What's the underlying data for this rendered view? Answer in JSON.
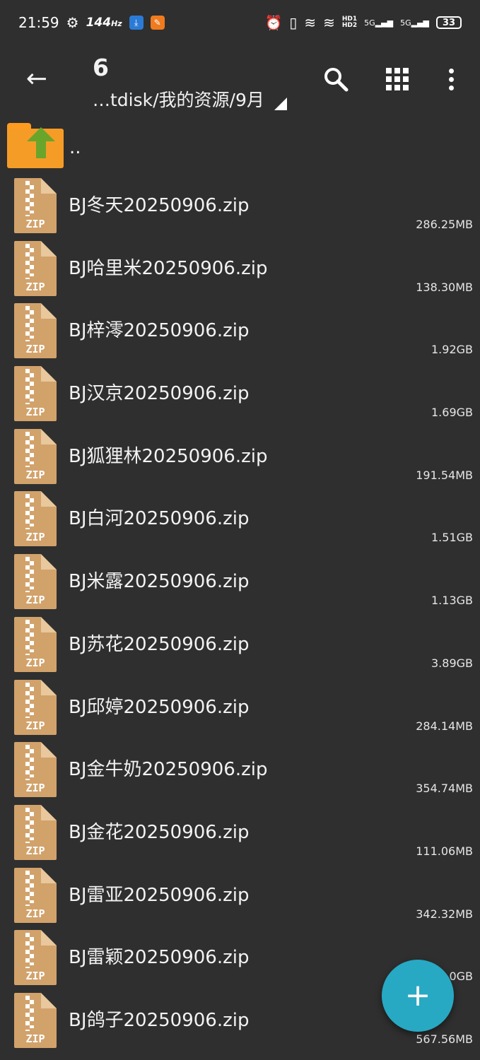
{
  "status_bar": {
    "time": "21:59",
    "refresh_rate": "144",
    "refresh_unit": "Hz",
    "network_labels": [
      "HD1",
      "HD2",
      "5G",
      "5G"
    ],
    "battery": "33"
  },
  "app_bar": {
    "title": "6",
    "path": "…tdisk/我的资源/9月"
  },
  "parent_label": "..",
  "files": [
    {
      "name": "BJ冬天20250906.zip",
      "size": "286.25MB"
    },
    {
      "name": "BJ哈里米20250906.zip",
      "size": "138.30MB"
    },
    {
      "name": "BJ梓澪20250906.zip",
      "size": "1.92GB"
    },
    {
      "name": "BJ汉京20250906.zip",
      "size": "1.69GB"
    },
    {
      "name": "BJ狐狸林20250906.zip",
      "size": "191.54MB"
    },
    {
      "name": "BJ白河20250906.zip",
      "size": "1.51GB"
    },
    {
      "name": "BJ米露20250906.zip",
      "size": "1.13GB"
    },
    {
      "name": "BJ苏花20250906.zip",
      "size": "3.89GB"
    },
    {
      "name": "BJ邱婷20250906.zip",
      "size": "284.14MB"
    },
    {
      "name": "BJ金牛奶20250906.zip",
      "size": "354.74MB"
    },
    {
      "name": "BJ金花20250906.zip",
      "size": "111.06MB"
    },
    {
      "name": "BJ雷亚20250906.zip",
      "size": "342.32MB"
    },
    {
      "name": "BJ雷颖20250906.zip",
      "size": "0GB"
    },
    {
      "name": "BJ鸽子20250906.zip",
      "size": "567.56MB"
    }
  ],
  "zip_label": "ZIP",
  "fab_symbol": "+",
  "colors": {
    "background": "#2f2f2f",
    "fab": "#27a9c4",
    "zip": "#d2a26b",
    "folder": "#f59c27"
  }
}
